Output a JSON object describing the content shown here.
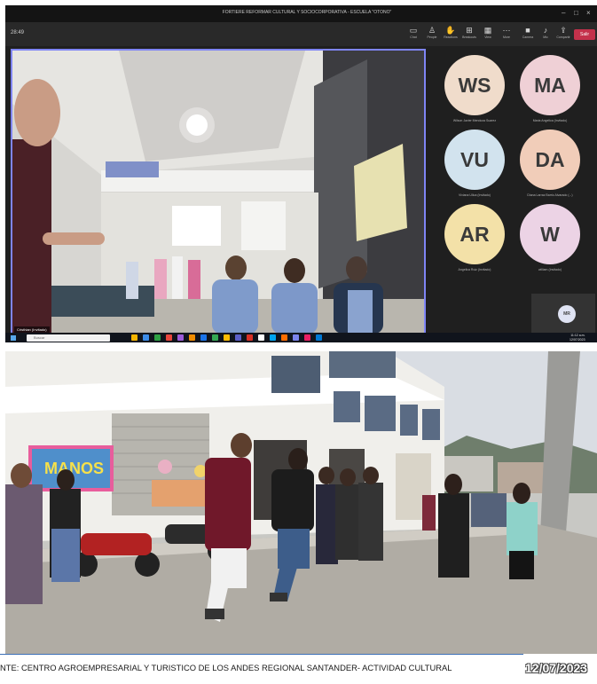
{
  "window": {
    "title": "FORTIERE REFORMAR CULTURAL Y SOCIOCORPORATIVA - ESCUELA \"OTOÑO\"",
    "controls": [
      "–",
      "□",
      "×"
    ]
  },
  "meeting_bar": {
    "timer": "28:49",
    "toolbar": [
      {
        "icon": "chat-icon",
        "label": "Chat"
      },
      {
        "icon": "people-icon",
        "label": "People"
      },
      {
        "icon": "raise-hand-icon",
        "label": "Reactions"
      },
      {
        "icon": "rooms-icon",
        "label": "Breakouts"
      },
      {
        "icon": "view-icon",
        "label": "View"
      },
      {
        "icon": "more-icon",
        "label": "More"
      },
      {
        "icon": "camera-icon",
        "label": "Camera"
      },
      {
        "icon": "mic-icon",
        "label": "Mic"
      },
      {
        "icon": "share-icon",
        "label": "Compartir"
      }
    ],
    "leave_label": "Salir",
    "leave_color": "#c4314b"
  },
  "main_video": {
    "participant_name": "Cristhian (Invitado)"
  },
  "participants": [
    {
      "initials": "WS",
      "name": "Wilson Javier Mendoza Suarez",
      "color": "#f0dccb"
    },
    {
      "initials": "MA",
      "name": "Maria Angelica (Invitado)",
      "color": "#efd0d6"
    },
    {
      "initials": "VU",
      "name": "Viviana Ulloa (Invitado)",
      "color": "#d2e3ee"
    },
    {
      "initials": "DA",
      "name": "Diana Larraz Barrio Alvarado (...)",
      "color": "#f1cdb9"
    },
    {
      "initials": "AR",
      "name": "Angelica Ruiz (Invitado)",
      "color": "#f3e1a8"
    },
    {
      "initials": "W",
      "name": "william (Invitado)",
      "color": "#ecd3e5"
    }
  ],
  "self_tile": {
    "initials": "MR"
  },
  "taskbar": {
    "search_placeholder": "Buscar",
    "time": "11:12 a.m.",
    "date": "12/07/2023",
    "icon_colors": [
      "#f4b400",
      "#3c8ce7",
      "#2ea043",
      "#e8453c",
      "#9c5bd9",
      "#f08c00",
      "#1a73e8",
      "#34a853",
      "#fbbc04",
      "#5b5fc7",
      "#d93025",
      "#ffffff",
      "#00a4ef",
      "#ff6d00",
      "#7b83eb",
      "#e91e63",
      "#0078d4"
    ]
  },
  "photo": {
    "banner_text": "MANOS",
    "caption": "NTE: CENTRO AGROEMPRESARIAL Y TURISTICO DE LOS ANDES REGIONAL SANTANDER- ACTIVIDAD CULTURAL",
    "date": "12/07/2023"
  }
}
